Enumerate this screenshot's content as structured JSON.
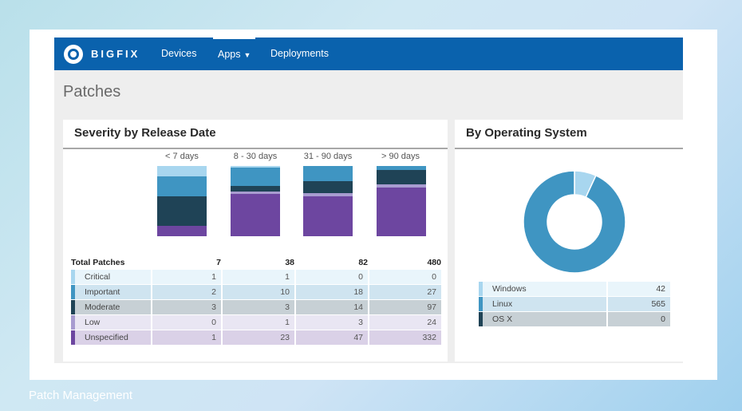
{
  "app": {
    "brand": "BIGFIX",
    "nav": {
      "devices": "Devices",
      "apps": "Apps",
      "deployments": "Deployments"
    },
    "page_title": "Patches"
  },
  "severity": {
    "title": "Severity by Release Date",
    "columns": [
      "< 7 days",
      "8 - 30 days",
      "31 - 90 days",
      "> 90 days"
    ],
    "total_label": "Total Patches",
    "totals": [
      "7",
      "38",
      "82",
      "480"
    ],
    "rows": [
      {
        "label": "Critical",
        "color": "#a8d6ef",
        "values": [
          "1",
          "1",
          "0",
          "0"
        ]
      },
      {
        "label": "Important",
        "color": "#3f95c2",
        "values": [
          "2",
          "10",
          "18",
          "27"
        ]
      },
      {
        "label": "Moderate",
        "color": "#1f4356",
        "values": [
          "3",
          "3",
          "14",
          "97"
        ]
      },
      {
        "label": "Low",
        "color": "#a89cd0",
        "values": [
          "0",
          "1",
          "3",
          "24"
        ]
      },
      {
        "label": "Unspecified",
        "color": "#6d46a0",
        "values": [
          "1",
          "23",
          "47",
          "332"
        ]
      }
    ]
  },
  "os": {
    "title": "By Operating System",
    "rows": [
      {
        "label": "Windows",
        "value": "42",
        "color": "#a8d6ef"
      },
      {
        "label": "Linux",
        "value": "565",
        "color": "#3f95c2"
      },
      {
        "label": "OS X",
        "value": "0",
        "color": "#1f4356"
      }
    ]
  },
  "caption": "Patch Management"
}
